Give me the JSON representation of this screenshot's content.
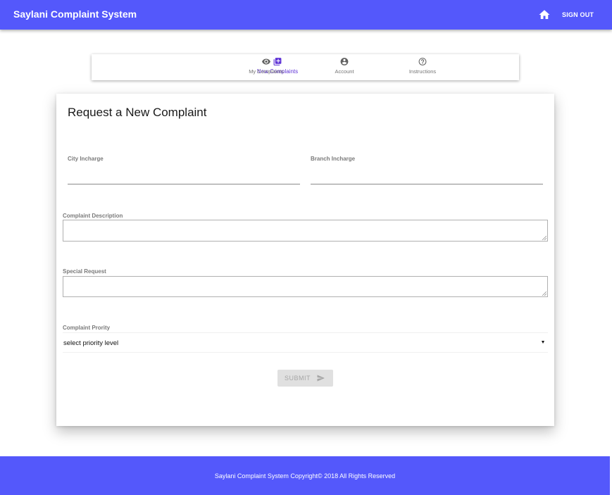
{
  "app": {
    "title": "Saylani Complaint System",
    "signout_label": "SIGN OUT",
    "home_icon": "home-icon",
    "brand_color": "#5458fb"
  },
  "nav": {
    "tabs": [
      {
        "label": "New Complaints",
        "icon": "add-box-icon",
        "active": true
      },
      {
        "label": "My Complaints",
        "icon": "eye-icon",
        "active": false
      },
      {
        "label": "Account",
        "icon": "account-circle-icon",
        "active": false
      },
      {
        "label": "Instructions",
        "icon": "help-circle-icon",
        "active": false
      }
    ],
    "active_color": "#5f33d6"
  },
  "form": {
    "title": "Request a New Complaint",
    "city_incharge": {
      "label": "City Incharge",
      "value": ""
    },
    "branch_incharge": {
      "label": "Branch Incharge",
      "value": ""
    },
    "complaint_description": {
      "label": "Complaint Description",
      "value": ""
    },
    "special_request": {
      "label": "Special Request",
      "value": ""
    },
    "complaint_priority": {
      "label": "Complaint Prority",
      "selected": "select priority level"
    },
    "submit": {
      "label": "SUBMIT",
      "icon": "send-icon",
      "disabled": true
    }
  },
  "footer": {
    "text": "Saylani Complaint System Copyright© 2018 All Rights Reserved"
  }
}
